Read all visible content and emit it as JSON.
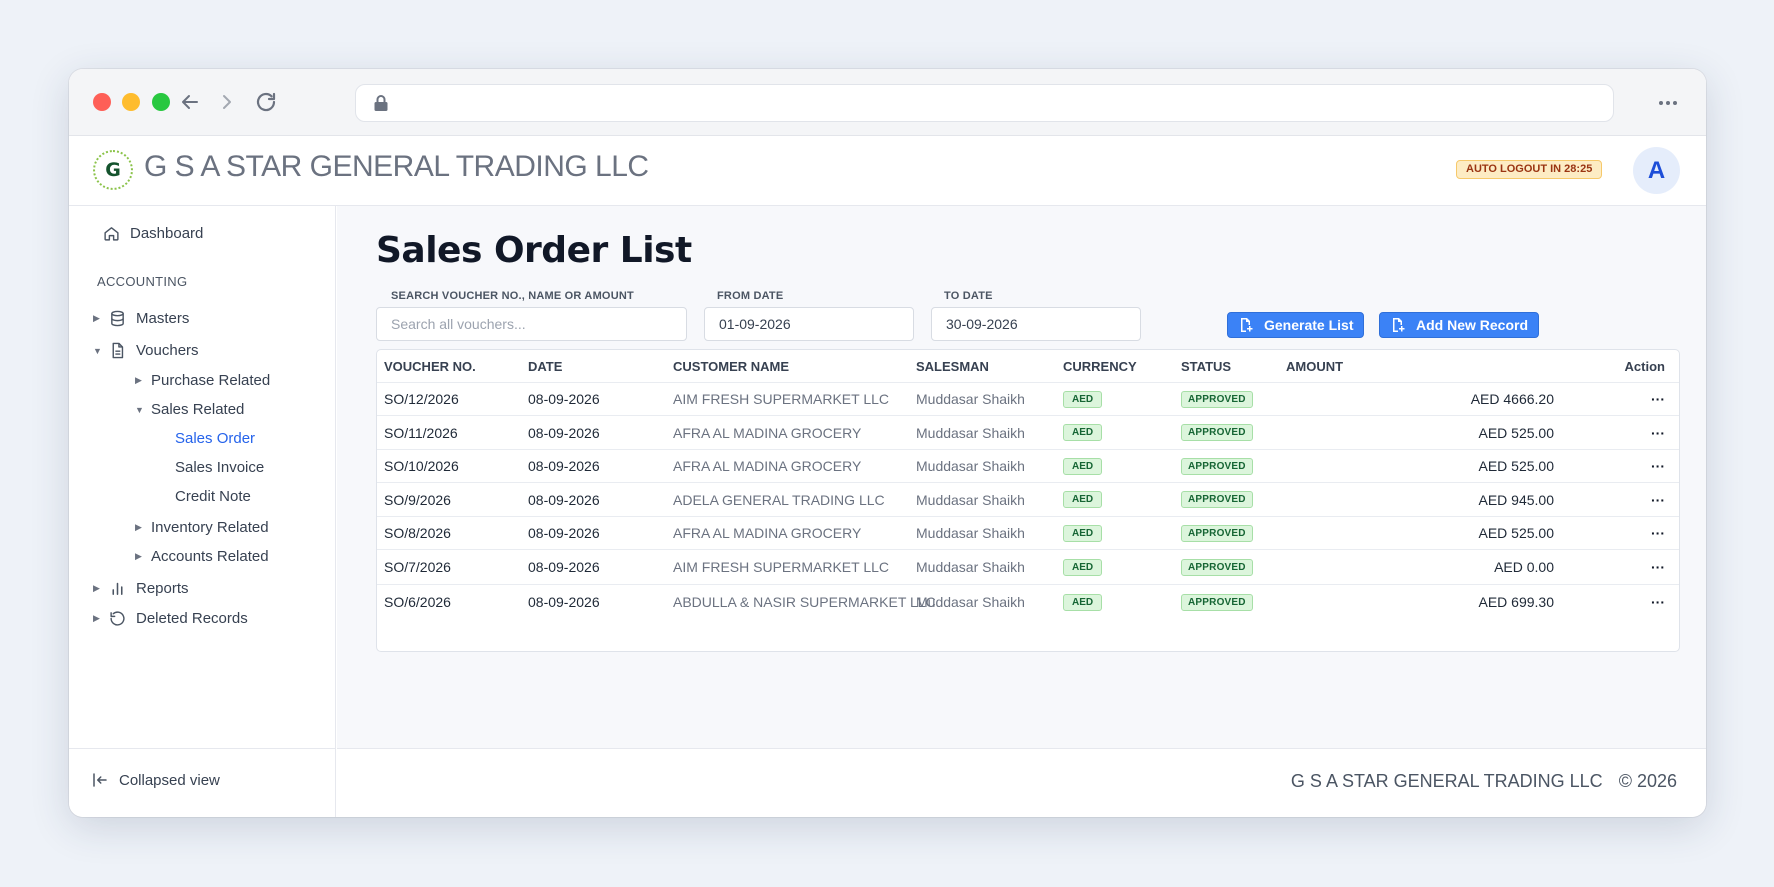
{
  "header": {
    "company": "G S A STAR GENERAL TRADING LLC",
    "logo_letter": "G",
    "auto_logout": "AUTO LOGOUT IN 28:25",
    "avatar_letter": "A"
  },
  "sidebar": {
    "dashboard": "Dashboard",
    "section": "ACCOUNTING",
    "masters": "Masters",
    "vouchers": "Vouchers",
    "purchase_related": "Purchase Related",
    "sales_related": "Sales Related",
    "sales_order": "Sales Order",
    "sales_invoice": "Sales Invoice",
    "credit_note": "Credit Note",
    "inventory_related": "Inventory Related",
    "accounts_related": "Accounts Related",
    "reports": "Reports",
    "deleted_records": "Deleted Records",
    "collapsed_view": "Collapsed view"
  },
  "main": {
    "title": "Sales Order List",
    "search_label": "SEARCH VOUCHER NO., NAME OR AMOUNT",
    "search_placeholder": "Search all vouchers...",
    "from_label": "FROM DATE",
    "from_value": "01-09-2026",
    "to_label": "TO DATE",
    "to_value": "30-09-2026",
    "generate_label": "Generate List",
    "add_label": "Add New Record"
  },
  "table": {
    "headers": {
      "voucher": "VOUCHER NO.",
      "date": "DATE",
      "customer": "CUSTOMER NAME",
      "salesman": "SALESMAN",
      "currency": "CURRENCY",
      "status": "STATUS",
      "amount": "AMOUNT",
      "action": "Action"
    },
    "rows": [
      {
        "voucher": "SO/12/2026",
        "date": "08-09-2026",
        "customer": "AIM FRESH SUPERMARKET LLC",
        "salesman": "Muddasar Shaikh",
        "currency": "AED",
        "status": "APPROVED",
        "amount": "AED 4666.20",
        "action": "···"
      },
      {
        "voucher": "SO/11/2026",
        "date": "08-09-2026",
        "customer": "AFRA AL MADINA GROCERY",
        "salesman": "Muddasar Shaikh",
        "currency": "AED",
        "status": "APPROVED",
        "amount": "AED 525.00",
        "action": "···"
      },
      {
        "voucher": "SO/10/2026",
        "date": "08-09-2026",
        "customer": "AFRA AL MADINA GROCERY",
        "salesman": "Muddasar Shaikh",
        "currency": "AED",
        "status": "APPROVED",
        "amount": "AED 525.00",
        "action": "···"
      },
      {
        "voucher": "SO/9/2026",
        "date": "08-09-2026",
        "customer": "ADELA GENERAL TRADING LLC",
        "salesman": "Muddasar Shaikh",
        "currency": "AED",
        "status": "APPROVED",
        "amount": "AED 945.00",
        "action": "···"
      },
      {
        "voucher": "SO/8/2026",
        "date": "08-09-2026",
        "customer": "AFRA AL MADINA GROCERY",
        "salesman": "Muddasar Shaikh",
        "currency": "AED",
        "status": "APPROVED",
        "amount": "AED 525.00",
        "action": "···"
      },
      {
        "voucher": "SO/7/2026",
        "date": "08-09-2026",
        "customer": "AIM FRESH SUPERMARKET LLC",
        "salesman": "Muddasar Shaikh",
        "currency": "AED",
        "status": "APPROVED",
        "amount": "AED 0.00",
        "action": "···"
      },
      {
        "voucher": "SO/6/2026",
        "date": "08-09-2026",
        "customer": "ABDULLA & NASIR SUPERMARKET LLC",
        "salesman": "Muddasar Shaikh",
        "currency": "AED",
        "status": "APPROVED",
        "amount": "AED 699.30",
        "action": "···"
      }
    ]
  },
  "footer": {
    "company": "G S A STAR GENERAL TRADING LLC",
    "copyright": "© 2026"
  },
  "colors": {
    "accent": "#3b82f6",
    "active_link": "#2563eb",
    "badge_green_bg": "#dcf5dc",
    "badge_green_text": "#166534",
    "logout_bg": "#fdecc4"
  },
  "icons": {
    "back": "arrow-left-icon",
    "forward": "arrow-right-icon",
    "reload": "reload-icon",
    "lock": "lock-icon",
    "more": "more-dots-icon",
    "dashboard": "home-icon",
    "masters": "database-icon",
    "vouchers": "document-icon",
    "reports": "bar-chart-icon",
    "deleted": "history-icon",
    "collapse": "collapse-left-icon",
    "add_doc": "add-document-icon"
  }
}
